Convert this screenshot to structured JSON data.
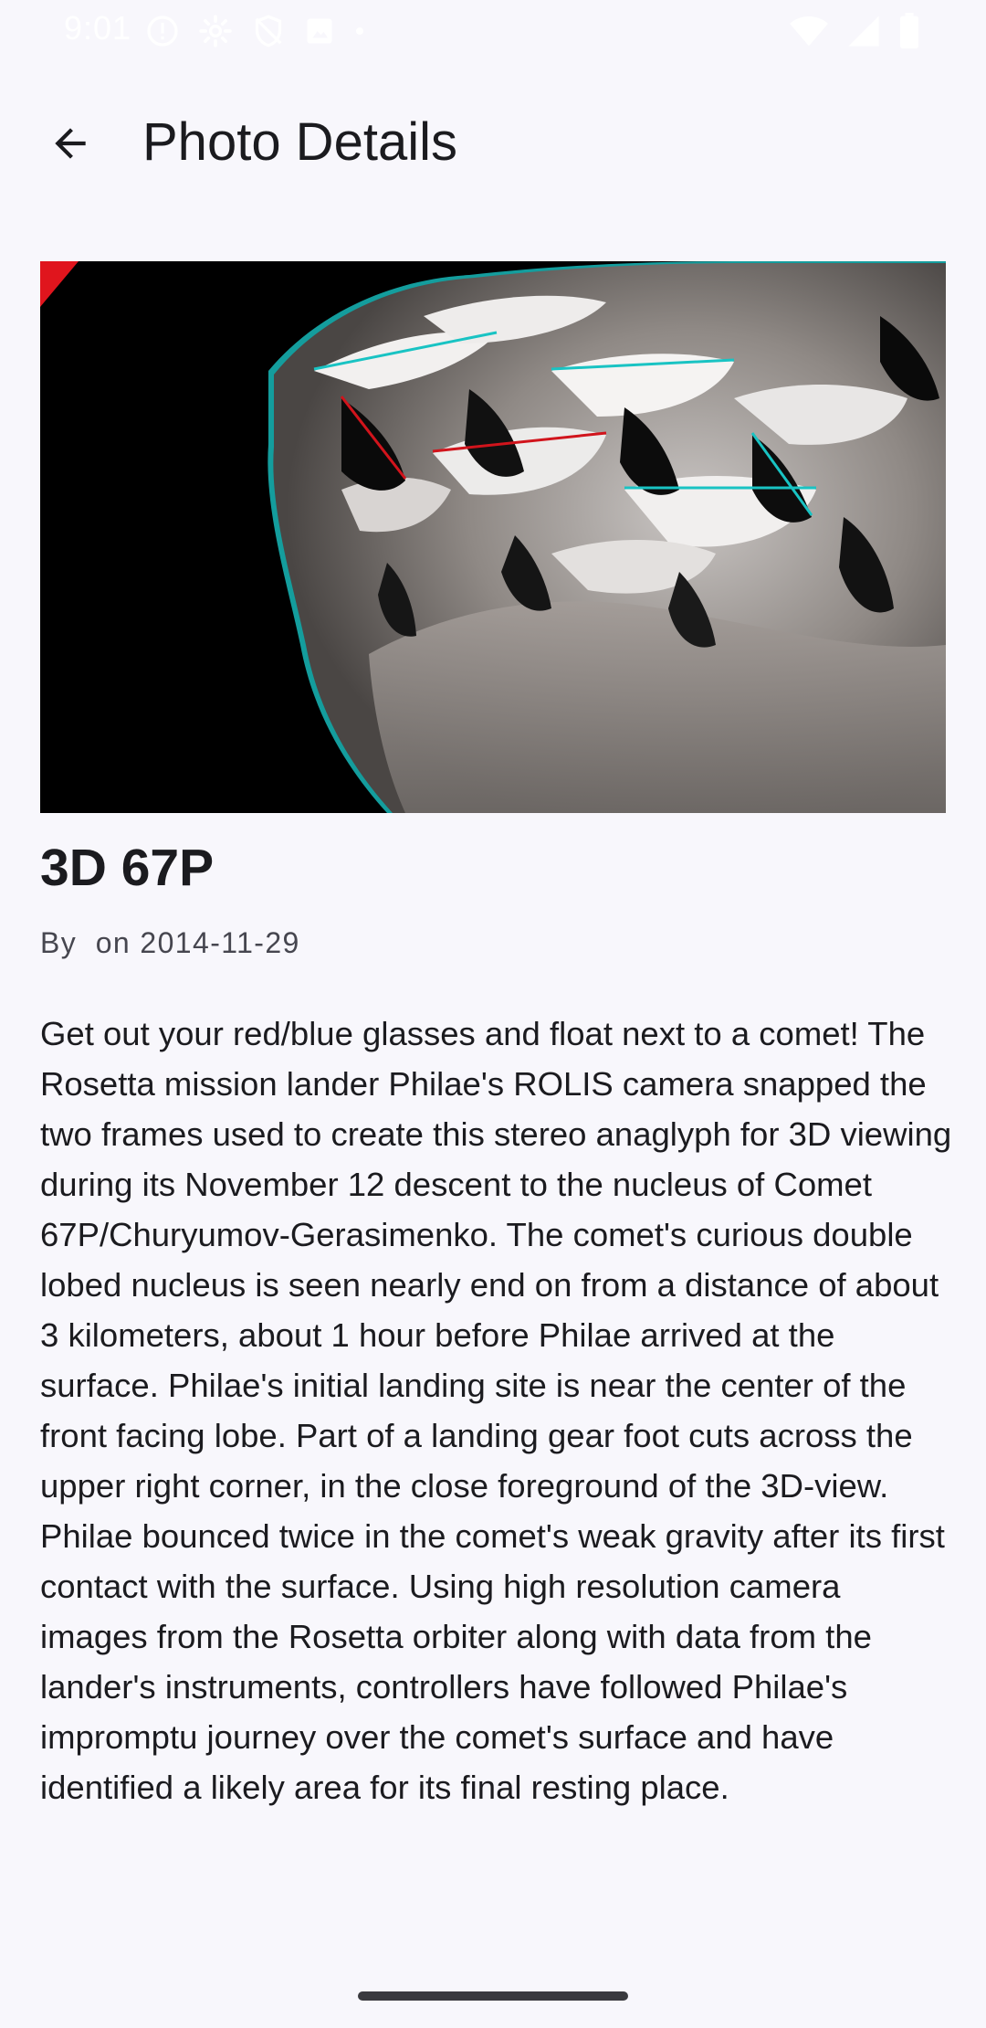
{
  "status_bar": {
    "time": "9:01",
    "left_icons": [
      "alert-circle-icon",
      "settings-gear-icon",
      "shield-off-icon",
      "notification-square-icon",
      "dot-icon"
    ],
    "right_icons": [
      "wifi-icon",
      "signal-icon",
      "battery-icon"
    ]
  },
  "app_bar": {
    "back_icon": "arrow-back-icon",
    "title": "Photo Details"
  },
  "photo": {
    "title": "3D 67P",
    "byline": "By  on 2014-11-29",
    "description": "Get out your red/blue glasses and float next to a comet! The Rosetta mission lander Philae's ROLIS camera snapped the two frames used to create this stereo anaglyph for 3D viewing during its November 12 descent to the nucleus of Comet 67P/Churyumov-Gerasimenko. The comet's curious double lobed nucleus is seen nearly end on from a distance of about 3 kilometers, about 1 hour before Philae arrived at the surface. Philae's initial landing site is near the center of the front facing lobe. Part of a landing gear foot cuts across the upper right corner, in the close foreground of the 3D-view. Philae bounced twice in the comet's weak gravity after its first contact with the surface. Using high resolution camera images from the Rosetta orbiter along with data from the lander's instruments, controllers have followed Philae's impromptu journey over the comet's surface and have identified a likely area for its final resting place."
  },
  "colors": {
    "background": "#f8f7fc",
    "text_primary": "#1b1b1f",
    "text_secondary": "#46464f"
  }
}
